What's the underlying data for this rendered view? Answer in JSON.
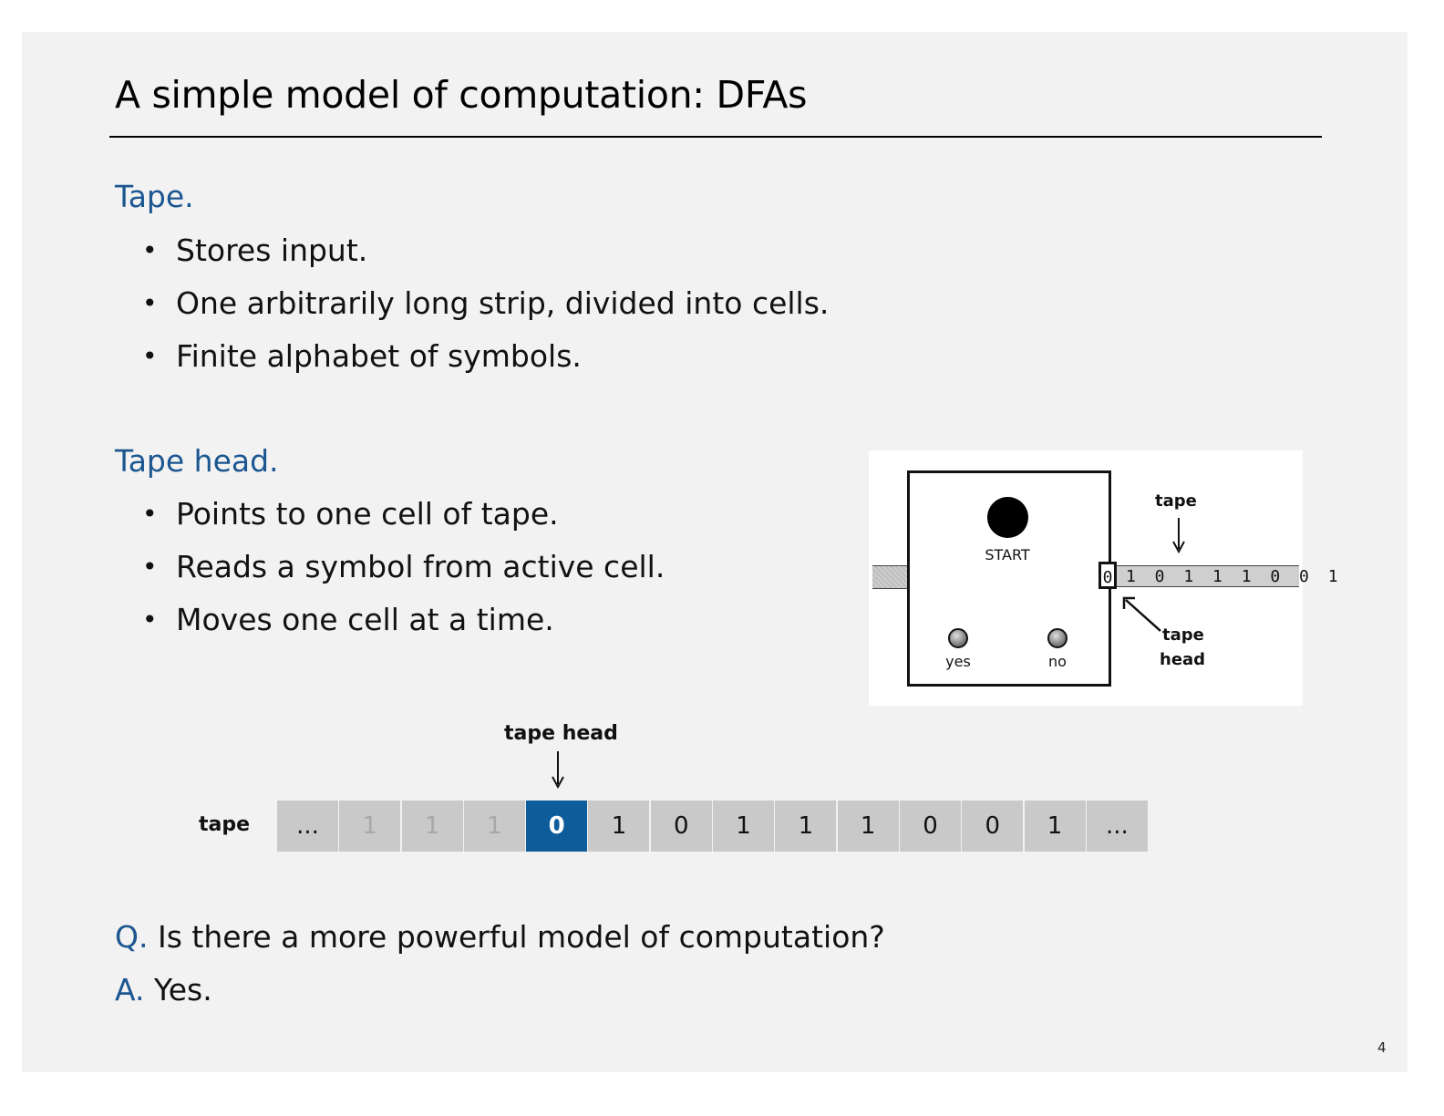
{
  "slide": {
    "title": "A simple model of computation:  DFAs",
    "page_number": "4"
  },
  "tape_section": {
    "heading": "Tape.",
    "bullets": [
      "Stores input.",
      "One arbitrarily long strip, divided into cells.",
      "Finite alphabet of symbols."
    ]
  },
  "head_section": {
    "heading": "Tape head.",
    "bullets": [
      "Points to one cell of tape.",
      "Reads a symbol from active cell.",
      "Moves one cell at a time."
    ]
  },
  "machine": {
    "start_label": "START",
    "yes_label": "yes",
    "no_label": "no",
    "head_symbol": "0",
    "tape_symbols": "1 0 1 1 1 0 0 1",
    "tape_label": "tape",
    "head_label_line1": "tape",
    "head_label_line2": "head"
  },
  "tape_diagram": {
    "tape_label": "tape",
    "head_label": "tape head",
    "cells": [
      "...",
      "1",
      "1",
      "1",
      "0",
      "1",
      "0",
      "1",
      "1",
      "1",
      "0",
      "0",
      "1",
      "..."
    ],
    "active_index": 4,
    "faded_indices": [
      1,
      2,
      3
    ]
  },
  "qa": {
    "q_tag": "Q.",
    "question": " Is there a more powerful model of computation?",
    "a_tag": "A.",
    "answer": " Yes."
  }
}
